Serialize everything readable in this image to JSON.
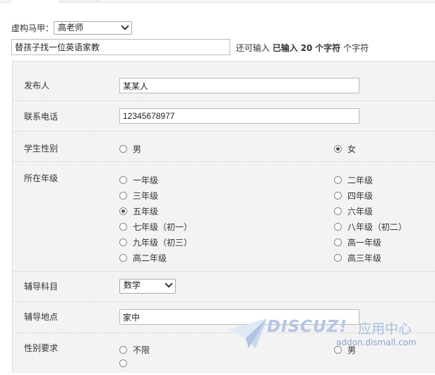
{
  "virtual_account": {
    "label": "虚构马甲：",
    "selected": "高老师"
  },
  "post_title": {
    "value": "替孩子找一位英语家教"
  },
  "char_hint": {
    "prefix": "还可输入",
    "entered_label": "已输入",
    "count": "20",
    "unit_bold": "个字符",
    "suffix": "个字符"
  },
  "fields": {
    "publisher": {
      "label": "发布人",
      "value": "某某人"
    },
    "phone": {
      "label": "联系电话",
      "value": "12345678977"
    },
    "student_gender": {
      "label": "学生性别",
      "options": [
        "男",
        "女"
      ],
      "selected": "女"
    },
    "grade": {
      "label": "所在年级",
      "options": [
        "一年级",
        "二年级",
        "三年级",
        "四年级",
        "五年级",
        "六年级",
        "七年级（初一）",
        "八年级（初二）",
        "九年级（初三）",
        "高一年级",
        "高二年级",
        "高三年级"
      ],
      "selected": "五年级"
    },
    "subject": {
      "label": "辅导科目",
      "selected": "数学"
    },
    "location": {
      "label": "辅导地点",
      "value": "家中"
    },
    "gender_requirement": {
      "label": "性别要求",
      "options": [
        "不限",
        "男"
      ]
    }
  },
  "watermark": {
    "brand": "DISCUZ!",
    "suffix": "应用中心",
    "domain": "addon.dismall.com"
  }
}
